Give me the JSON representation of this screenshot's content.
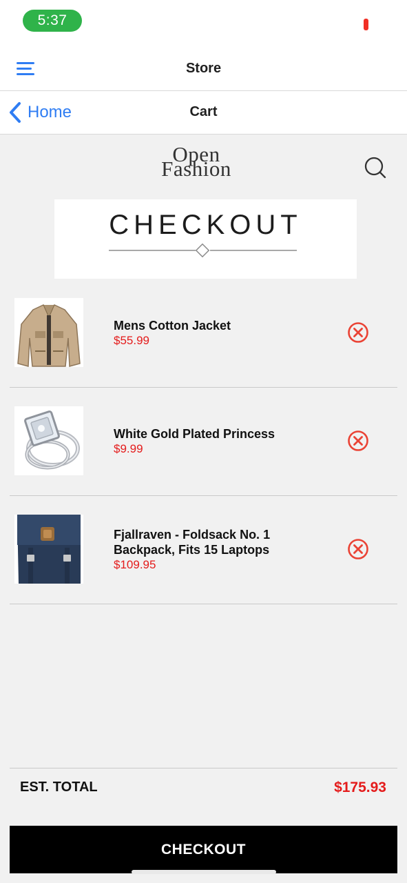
{
  "status_bar": {
    "time": "5:37",
    "clock_color": "#2fb34a",
    "battery_color": "#f12f25"
  },
  "store_bar": {
    "title": "Store",
    "menu_icon": "hamburger-menu-icon"
  },
  "cart_bar": {
    "back_label": "Home",
    "title": "Cart"
  },
  "brand": {
    "logo_line1": "Open",
    "logo_line2": "Fashion",
    "search_icon": "search-icon"
  },
  "banner": {
    "title": "CHECKOUT"
  },
  "cart": {
    "items": [
      {
        "name": "Mens Cotton Jacket",
        "price": "$55.99",
        "thumbnail": "jacket"
      },
      {
        "name": "White Gold Plated Princess",
        "price": "$9.99",
        "thumbnail": "ring"
      },
      {
        "name": "Fjallraven - Foldsack No. 1 Backpack, Fits 15 Laptops",
        "price": "$109.95",
        "thumbnail": "backpack"
      }
    ]
  },
  "summary": {
    "label": "EST. TOTAL",
    "value": "$175.93"
  },
  "actions": {
    "checkout_label": "CHECKOUT"
  },
  "colors": {
    "accent_blue": "#2f7df3",
    "price_red": "#e41b1b",
    "remove_red": "#ea4335",
    "background": "#f1f1f1",
    "checkout_button": "#000000"
  }
}
